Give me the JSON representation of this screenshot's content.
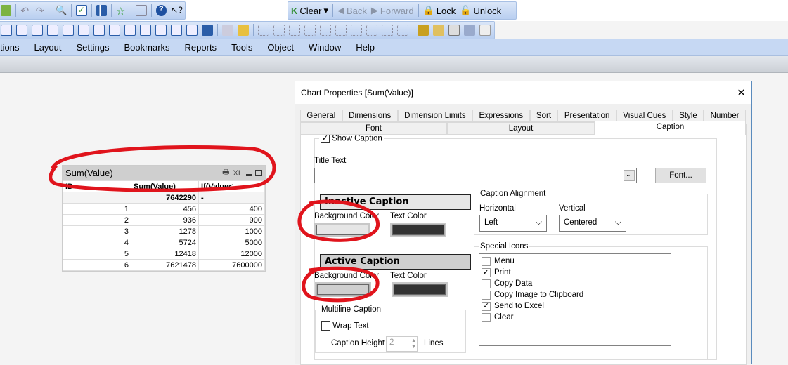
{
  "toolbar": {
    "clear": "Clear",
    "back": "Back",
    "forward": "Forward",
    "lock": "Lock",
    "unlock": "Unlock"
  },
  "menu": [
    "tions",
    "Layout",
    "Settings",
    "Bookmarks",
    "Reports",
    "Tools",
    "Object",
    "Window",
    "Help"
  ],
  "widget": {
    "caption": "Sum(Value)",
    "caption_icons": "XL",
    "headers": [
      "ID",
      "Sum(Value)",
      "If(Value<..."
    ],
    "total": [
      "",
      "7642290",
      "-"
    ],
    "rows": [
      [
        "1",
        "456",
        "400"
      ],
      [
        "2",
        "936",
        "900"
      ],
      [
        "3",
        "1278",
        "1000"
      ],
      [
        "4",
        "5724",
        "5000"
      ],
      [
        "5",
        "12418",
        "12000"
      ],
      [
        "6",
        "7621478",
        "7600000"
      ]
    ]
  },
  "dialog": {
    "title": "Chart Properties [Sum(Value)]",
    "close": "✕",
    "tabs1": [
      "General",
      "Dimensions",
      "Dimension Limits",
      "Expressions",
      "Sort",
      "Presentation",
      "Visual Cues",
      "Style",
      "Number"
    ],
    "tabs2": [
      "Font",
      "Layout",
      "Caption"
    ],
    "show_caption": "Show Caption",
    "title_text_label": "Title Text",
    "title_text_value": "",
    "ellipsis": "...",
    "font_button": "Font...",
    "inactive_caption": "Inactive Caption",
    "active_caption": "Active Caption",
    "bg_color": "Background Color",
    "text_color": "Text Color",
    "colors": {
      "inactive_bg": "#e6e6e6",
      "inactive_text": "#333333",
      "active_bg": "#cfcfcf",
      "active_text": "#333333"
    },
    "alignment": {
      "legend": "Caption Alignment",
      "horizontal_label": "Horizontal",
      "horizontal": "Left",
      "vertical_label": "Vertical",
      "vertical": "Centered"
    },
    "multiline": {
      "legend": "Multiline Caption",
      "wrap_text": "Wrap Text",
      "caption_height_label": "Caption Height",
      "caption_height": "2",
      "lines": "Lines"
    },
    "special_icons": {
      "legend": "Special Icons",
      "items": [
        {
          "label": "Menu",
          "checked": false
        },
        {
          "label": "Print",
          "checked": true
        },
        {
          "label": "Copy Data",
          "checked": false
        },
        {
          "label": "Copy Image to Clipboard",
          "checked": false
        },
        {
          "label": "Send to Excel",
          "checked": true
        },
        {
          "label": "Clear",
          "checked": false
        }
      ]
    }
  }
}
